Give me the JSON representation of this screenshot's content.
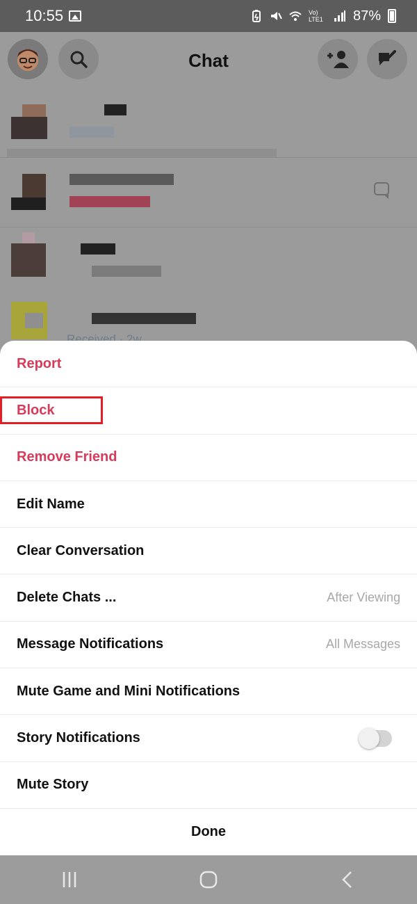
{
  "status_bar": {
    "time": "10:55",
    "battery": "87%",
    "network": "Vo) LTE1"
  },
  "header": {
    "title": "Chat"
  },
  "chats": {
    "received_status": "Received · 2w"
  },
  "sheet": {
    "items": [
      {
        "label": "Report",
        "style": "destructive"
      },
      {
        "label": "Block",
        "style": "destructive"
      },
      {
        "label": "Remove Friend",
        "style": "destructive"
      },
      {
        "label": "Edit Name"
      },
      {
        "label": "Clear Conversation"
      },
      {
        "label": "Delete Chats ...",
        "value": "After Viewing"
      },
      {
        "label": "Message Notifications",
        "value": "All Messages"
      },
      {
        "label": "Mute Game and Mini Notifications"
      },
      {
        "label": "Story Notifications",
        "toggle": "off"
      },
      {
        "label": "Mute Story"
      }
    ],
    "done_label": "Done"
  },
  "colors": {
    "destructive": "#d63b5a",
    "highlight_box": "#e31e24"
  }
}
